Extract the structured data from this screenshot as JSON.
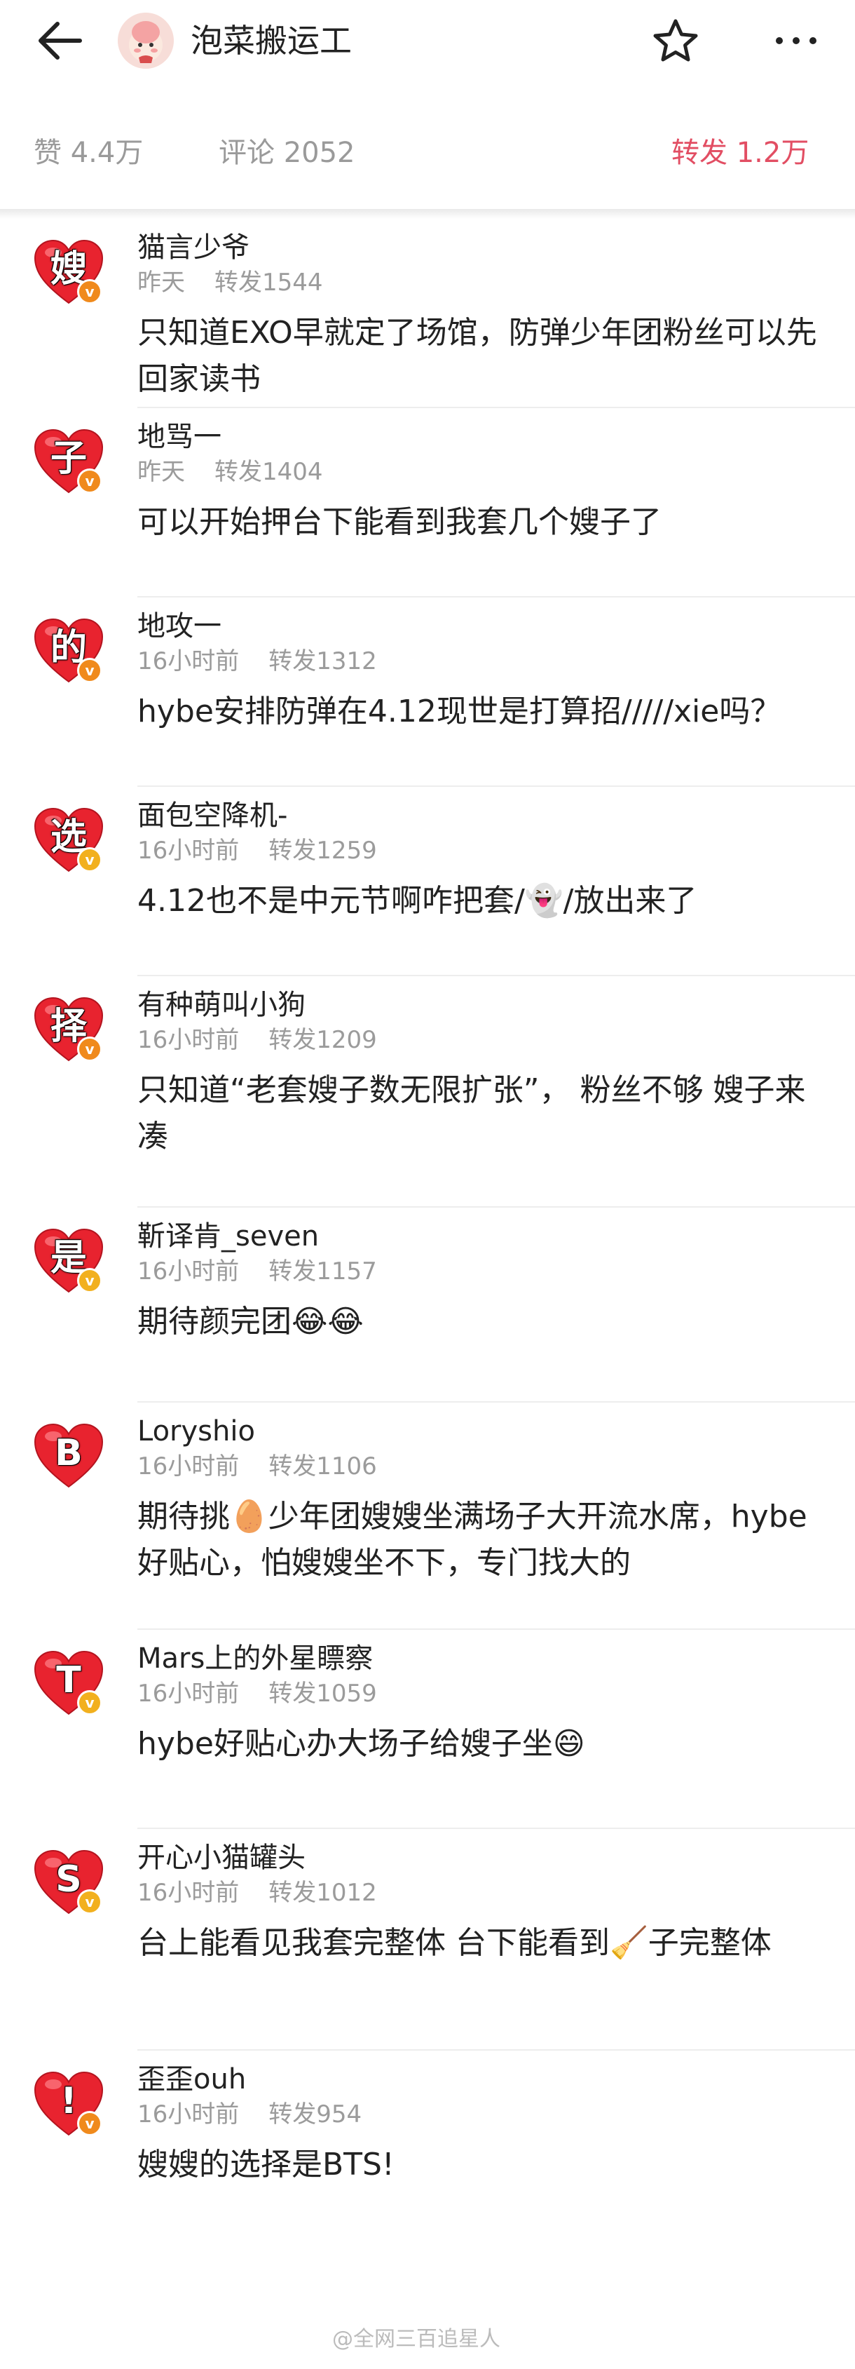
{
  "header": {
    "title": "泡菜搬运工",
    "icons": {
      "back": "arrow-left-icon",
      "star": "star-icon",
      "more": "more-dots-icon"
    }
  },
  "stats": {
    "likes": "赞 4.4万",
    "comments": "评论 2052",
    "reposts": "转发 1.2万",
    "active_color": "#e24e63"
  },
  "reposts": [
    {
      "avatar_char": "嫂",
      "badge_color": "#f08a1c",
      "name": "猫言少爷",
      "time": "昨天",
      "count": "转发1544",
      "content": "只知道EXO早就定了场馆，防弹少年团粉丝可以先回家读书"
    },
    {
      "avatar_char": "子",
      "badge_color": "#f08a1c",
      "name": "地骂一",
      "time": "昨天",
      "count": "转发1404",
      "content": "可以开始押台下能看到我套几个嫂子了"
    },
    {
      "avatar_char": "的",
      "badge_color": "#f08a1c",
      "name": "地攻一",
      "time": "16小时前",
      "count": "转发1312",
      "content": "hybe安排防弹在4.12现世是打算招/////xie吗？"
    },
    {
      "avatar_char": "选",
      "badge_color": "#f2b01e",
      "name": "面包空降机-",
      "time": "16小时前",
      "count": "转发1259",
      "content": "4.12也不是中元节啊咋把套/👻/放出来了"
    },
    {
      "avatar_char": "择",
      "badge_color": "#f08a1c",
      "name": "有种萌叫小狗",
      "time": "16小时前",
      "count": "转发1209",
      "content": "只知道“老套嫂子数无限扩张”， 粉丝不够 嫂子来凑"
    },
    {
      "avatar_char": "是",
      "badge_color": "#f2b01e",
      "name": "靳译肯_seven",
      "time": "16小时前",
      "count": "转发1157",
      "content": "期待颜完团😂😂"
    },
    {
      "avatar_char": "B",
      "badge_color": "",
      "name": "Loryshio",
      "time": "16小时前",
      "count": "转发1106",
      "content": "期待挑🥚少年团嫂嫂坐满场子大开流水席，hybe好贴心，怕嫂嫂坐不下，专门找大的"
    },
    {
      "avatar_char": "T",
      "badge_color": "#f2b01e",
      "name": "Mars上的外星瞟察",
      "time": "16小时前",
      "count": "转发1059",
      "content": "hybe好贴心办大场子给嫂子坐😄"
    },
    {
      "avatar_char": "S",
      "badge_color": "#f2b01e",
      "name": "开心小猫罐头",
      "time": "16小时前",
      "count": "转发1012",
      "content": "台上能看见我套完整体 台下能看到🧹子完整体"
    },
    {
      "avatar_char": "!",
      "badge_color": "#f08a1c",
      "name": "歪歪ouh",
      "time": "16小时前",
      "count": "转发954",
      "content": "嫂嫂的选择是BTS!"
    }
  ],
  "watermark": "@全网三百追星人",
  "heart_color": "#e8232f"
}
